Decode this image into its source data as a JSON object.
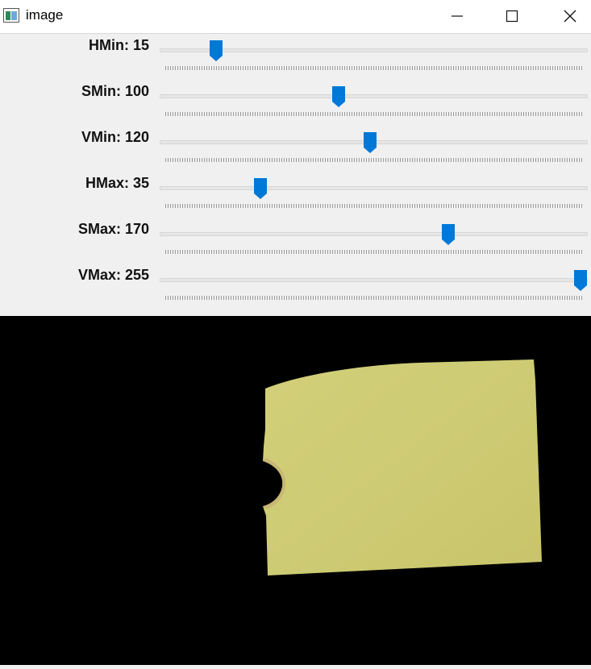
{
  "window": {
    "title": "image",
    "icon": "app-window-icon",
    "buttons": [
      "minimize-icon",
      "maximize-icon",
      "close-icon"
    ]
  },
  "trackbars": [
    {
      "label": "HMin: 15",
      "value": 15,
      "max": 179
    },
    {
      "label": "SMin: 100",
      "value": 100,
      "max": 255
    },
    {
      "label": "VMin: 120",
      "value": 120,
      "max": 255
    },
    {
      "label": "HMax: 35",
      "value": 35,
      "max": 179
    },
    {
      "label": "SMax: 170",
      "value": 170,
      "max": 255
    },
    {
      "label": "VMax: 255",
      "value": 255,
      "max": 255
    }
  ],
  "colors": {
    "thumb": "#0078d7",
    "masked_object": "#cdca74",
    "background": "#000000"
  }
}
